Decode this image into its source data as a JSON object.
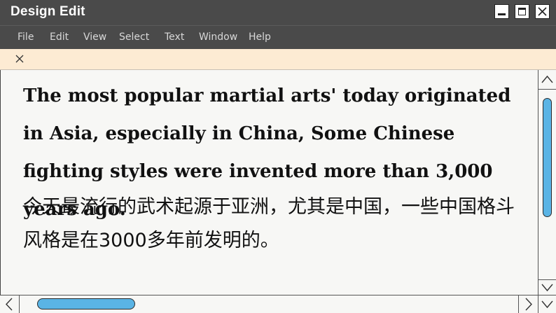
{
  "window": {
    "title": "Design Edit",
    "controls": [
      "minimize-icon",
      "maximize-icon",
      "close-icon"
    ]
  },
  "menu": {
    "items": [
      "File",
      "Edit",
      "View",
      "Select",
      "Text",
      "Window",
      "Help"
    ]
  },
  "tab": {
    "close_icon": "close-icon"
  },
  "document": {
    "english": "The most popular martial arts' today originated in Asia, especially in China, Some Chinese fighting styles were invented more than 3,000 years ago.",
    "chinese": "今天最流行的武术起源于亚洲，尤其是中国，一些中国格斗风格是在3000多年前发明的。"
  },
  "colors": {
    "titlebar": "#4a4a4a",
    "tabbar": "#fdebd3",
    "scroll_thumb": "#5ab4e5",
    "page": "#f7f7f5"
  }
}
